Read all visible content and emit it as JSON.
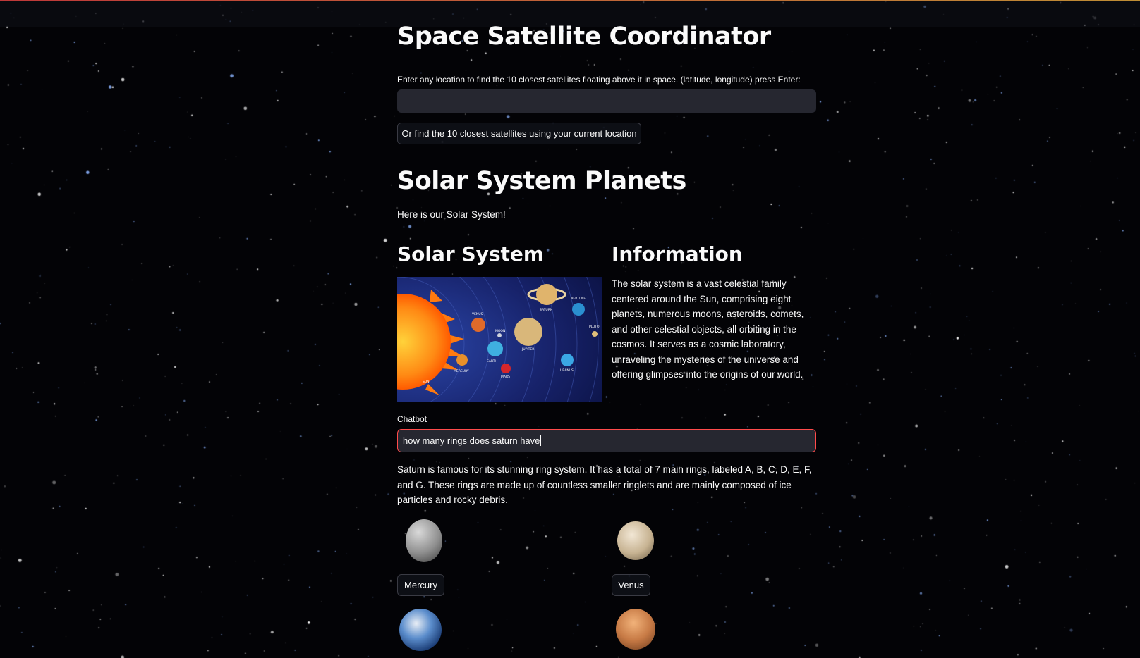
{
  "header": {
    "title": "Space Satellite Coordinator"
  },
  "satellite_search": {
    "prompt": "Enter any location to find the 10 closest satellites floating above it in space. (latitude, longitude) press Enter:",
    "value": "",
    "current_location_button": "Or find the 10 closest satellites using your current location"
  },
  "solar_section": {
    "title": "Solar System Planets",
    "intro": "Here is our Solar System!",
    "left_heading": "Solar System",
    "right_heading": "Information",
    "info_text": "The solar system is a vast celestial family centered around the Sun, comprising eight planets, numerous moons, asteroids, comets, and other celestial objects, all orbiting in the cosmos. It serves as a cosmic laboratory, unraveling the mysteries of the universe and offering glimpses into the origins of our world.",
    "diagram_labels": {
      "sun": "SUN",
      "mercury": "MERCURY",
      "venus": "VENUS",
      "moon": "MOON",
      "earth": "EARTH",
      "mars": "MARS",
      "jupiter": "JUPITER",
      "saturn": "SATURN",
      "uranus": "URANUS",
      "neptune": "NEPTUNE",
      "pluto": "PLUTO"
    }
  },
  "chatbot": {
    "label": "Chatbot",
    "input_value": "how many rings does saturn have",
    "response": "Saturn is famous for its stunning ring system. It has a total of 7 main rings, labeled A, B, C, D, E, F, and G. These rings are made up of countless smaller ringlets and are mainly composed of ice particles and rocky debris."
  },
  "planets": [
    {
      "name": "Mercury",
      "icon": "mercury-icon",
      "color": "#9a9a9a"
    },
    {
      "name": "Venus",
      "icon": "venus-icon",
      "color": "#d9c9b0"
    },
    {
      "name": "Earth",
      "icon": "earth-icon",
      "color": "#3f74b8"
    },
    {
      "name": "Mars",
      "icon": "mars-icon",
      "color": "#c77a45"
    }
  ],
  "colors": {
    "background": "#030306",
    "accent": "#ff4b4b",
    "input_bg": "#262730"
  }
}
